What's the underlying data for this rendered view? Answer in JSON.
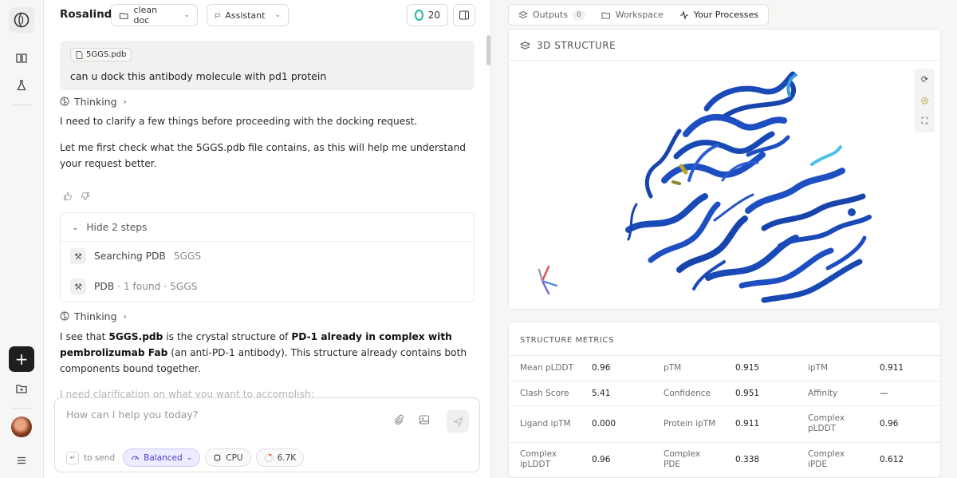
{
  "app": {
    "brand": "Rosalind"
  },
  "topbar": {
    "doc_select": "clean doc",
    "mode_select": "Assistant",
    "count": "20"
  },
  "chat": {
    "user_message": {
      "attachment": "5GGS.pdb",
      "text": "can u dock this antibody molecule with pd1 protein"
    },
    "thinking_label": "Thinking",
    "thinking_label_2": "Thinking",
    "reply_1": "I need to clarify a few things before proceeding with the docking request.",
    "reply_2": "Let me first check what the 5GGS.pdb file contains, as this will help me understand your request better.",
    "steps": {
      "toggle_label": "Hide 2 steps",
      "items": [
        {
          "label": "Searching PDB",
          "detail": "5GGS"
        },
        {
          "label": "PDB",
          "detail": "· 1 found",
          "detail2": "· 5GGS"
        }
      ]
    },
    "reply_3": {
      "part1": "I see that ",
      "bold1": "5GGS.pdb",
      "part2": " is the crystal structure of ",
      "bold2": "PD-1 already in complex with pembrolizumab Fab",
      "part3": " (an anti-PD-1 antibody). This structure already contains both components bound together."
    },
    "faded_line": "I need clarification on what you want to accomplish:"
  },
  "composer": {
    "placeholder": "How can I help you today?",
    "send_hint": "to send",
    "mode": "Balanced",
    "device": "CPU",
    "tokens": "6.7K"
  },
  "right": {
    "tabs": [
      {
        "label": "Outputs",
        "badge": "0"
      },
      {
        "label": "Workspace"
      },
      {
        "label": "Your Processes"
      }
    ],
    "structure_title": "3D STRUCTURE",
    "metrics_title": "STRUCTURE METRICS",
    "metrics": [
      [
        {
          "label": "Mean pLDDT",
          "value": "0.96"
        },
        {
          "label": "pTM",
          "value": "0.915"
        },
        {
          "label": "ipTM",
          "value": "0.911"
        }
      ],
      [
        {
          "label": "Clash Score",
          "value": "5.41"
        },
        {
          "label": "Confidence",
          "value": "0.951"
        },
        {
          "label": "Affinity",
          "value": "—"
        }
      ],
      [
        {
          "label": "Ligand ipTM",
          "value": "0.000"
        },
        {
          "label": "Protein ipTM",
          "value": "0.911"
        },
        {
          "label": "Complex pLDDT",
          "value": "0.96"
        }
      ],
      [
        {
          "label": "Complex ipLDDT",
          "value": "0.96"
        },
        {
          "label": "Complex PDE",
          "value": "0.338"
        },
        {
          "label": "Complex iPDE",
          "value": "0.612"
        }
      ]
    ]
  },
  "colors": {
    "accent": "#4b45c7",
    "ring": "#2bb6a3",
    "protein": "#1a49b8"
  }
}
